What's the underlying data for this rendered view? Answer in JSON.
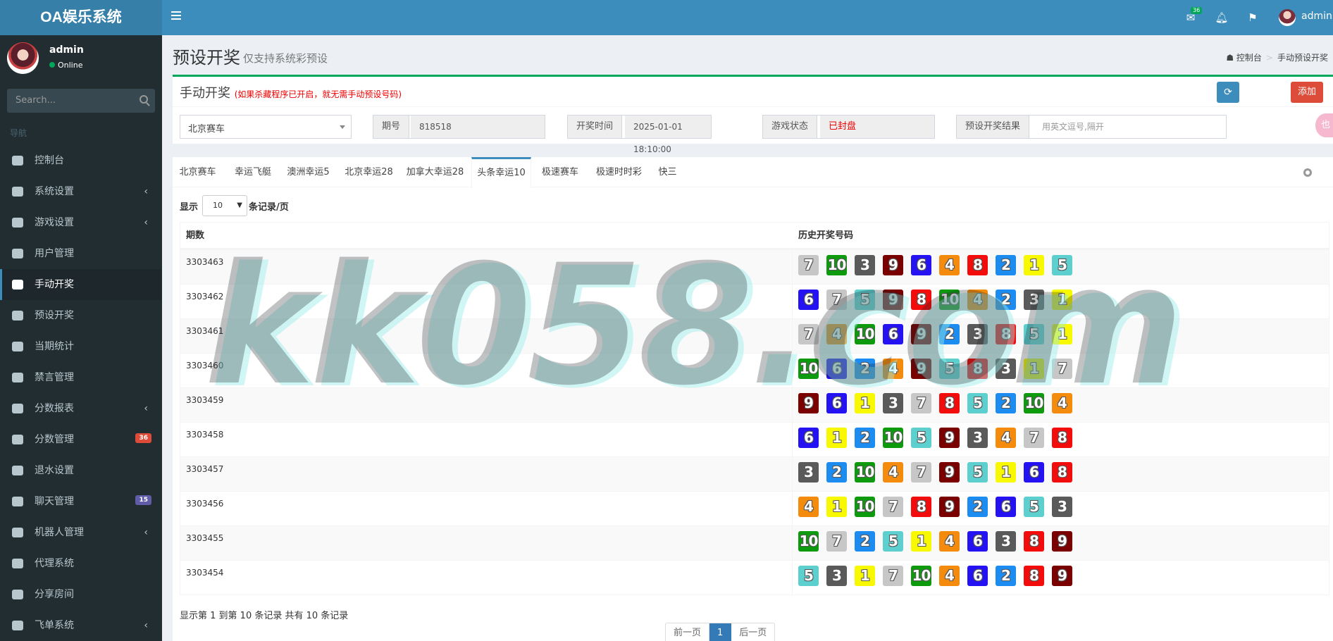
{
  "app": {
    "title": "OA娱乐系统"
  },
  "header": {
    "mail_badge": "36",
    "user": "admin"
  },
  "sidebar": {
    "user_name": "admin",
    "status": "Online",
    "search_placeholder": "Search...",
    "nav_header": "导航",
    "items": [
      {
        "label": "控制台",
        "icon": "dashboard-icon"
      },
      {
        "label": "系统设置",
        "icon": "gears-icon",
        "chevron": "‹"
      },
      {
        "label": "游戏设置",
        "icon": "gamepad-icon",
        "chevron": "‹"
      },
      {
        "label": "用户管理",
        "icon": "users-icon"
      },
      {
        "label": "手动开奖",
        "icon": "cubes-icon",
        "active": true
      },
      {
        "label": "预设开奖",
        "icon": "gear-icon"
      },
      {
        "label": "当期统计",
        "icon": "list-icon"
      },
      {
        "label": "禁言管理",
        "icon": "warning-icon"
      },
      {
        "label": "分数报表",
        "icon": "list-ol-icon",
        "chevron": "‹"
      },
      {
        "label": "分数管理",
        "icon": "database-icon",
        "badge": "36"
      },
      {
        "label": "退水设置",
        "icon": "cloud-download-icon"
      },
      {
        "label": "聊天管理",
        "icon": "comments-icon",
        "badge": "15"
      },
      {
        "label": "机器人管理",
        "icon": "comment-icon",
        "chevron": "‹"
      },
      {
        "label": "代理系统",
        "icon": "user-plus-icon"
      },
      {
        "label": "分享房间",
        "icon": "share-icon"
      },
      {
        "label": "飞单系统",
        "icon": "send-icon",
        "chevron": "‹"
      }
    ]
  },
  "page": {
    "title": "预设开奖",
    "subtitle": "仅支持系统彩预设",
    "breadcrumb": [
      "控制台",
      "手动预设开奖"
    ]
  },
  "form": {
    "title": "手动开奖",
    "notice": "(如果杀藏程序已开启，就无需手动预设号码)",
    "refresh_icon": "refresh-icon",
    "add_label": "添加",
    "side_tab": "也",
    "game_select": "北京赛车",
    "issue_label": "期号",
    "issue_value": "818518",
    "time_label": "开奖时间",
    "time_value": "2025-01-01 18:10:00",
    "status_label": "游戏状态",
    "status_value": "已封盘",
    "preset_label": "预设开奖结果",
    "preset_placeholder": "用英文逗号,隔开"
  },
  "tabs": [
    "北京赛车",
    "幸运飞艇",
    "澳洲幸运5",
    "北京幸运28",
    "加拿大幸运28",
    "头条幸运10",
    "极速赛车",
    "极速时时彩",
    "快三"
  ],
  "active_tab": 5,
  "table": {
    "show_label": "显示",
    "page_size": "10",
    "per_page_label": "条记录/页",
    "headers": [
      "期数",
      "历史开奖号码"
    ],
    "ball_colors": {
      "1": "#f8f800",
      "2": "#1d8cf0",
      "3": "#5a5a5a",
      "4": "#f58b0c",
      "5": "#5ecfcf",
      "6": "#2412f2",
      "7": "#c7c7c7",
      "8": "#f20c0c",
      "9": "#7a0000",
      "10": "#0d9a0d"
    },
    "rows": [
      {
        "issue": "3303463",
        "balls": [
          7,
          10,
          3,
          9,
          6,
          4,
          8,
          2,
          1,
          5
        ]
      },
      {
        "issue": "3303462",
        "balls": [
          6,
          7,
          5,
          9,
          8,
          10,
          4,
          2,
          3,
          1
        ]
      },
      {
        "issue": "3303461",
        "balls": [
          7,
          4,
          10,
          6,
          9,
          2,
          3,
          8,
          5,
          1
        ]
      },
      {
        "issue": "3303460",
        "balls": [
          10,
          6,
          2,
          4,
          9,
          5,
          8,
          3,
          1,
          7
        ]
      },
      {
        "issue": "3303459",
        "balls": [
          9,
          6,
          1,
          3,
          7,
          8,
          5,
          2,
          10,
          4
        ]
      },
      {
        "issue": "3303458",
        "balls": [
          6,
          1,
          2,
          10,
          5,
          9,
          3,
          4,
          7,
          8
        ]
      },
      {
        "issue": "3303457",
        "balls": [
          3,
          2,
          10,
          4,
          7,
          9,
          5,
          1,
          6,
          8
        ]
      },
      {
        "issue": "3303456",
        "balls": [
          4,
          1,
          10,
          7,
          8,
          9,
          2,
          6,
          5,
          3
        ]
      },
      {
        "issue": "3303455",
        "balls": [
          10,
          7,
          2,
          5,
          1,
          4,
          6,
          3,
          8,
          9
        ]
      },
      {
        "issue": "3303454",
        "balls": [
          5,
          3,
          1,
          7,
          10,
          4,
          6,
          2,
          8,
          9
        ]
      }
    ],
    "info": "显示第 1 到第 10 条记录 共有 10 条记录",
    "pager": {
      "prev": "前一页",
      "current": "1",
      "next": "后一页"
    }
  },
  "watermark": "kk058.com"
}
